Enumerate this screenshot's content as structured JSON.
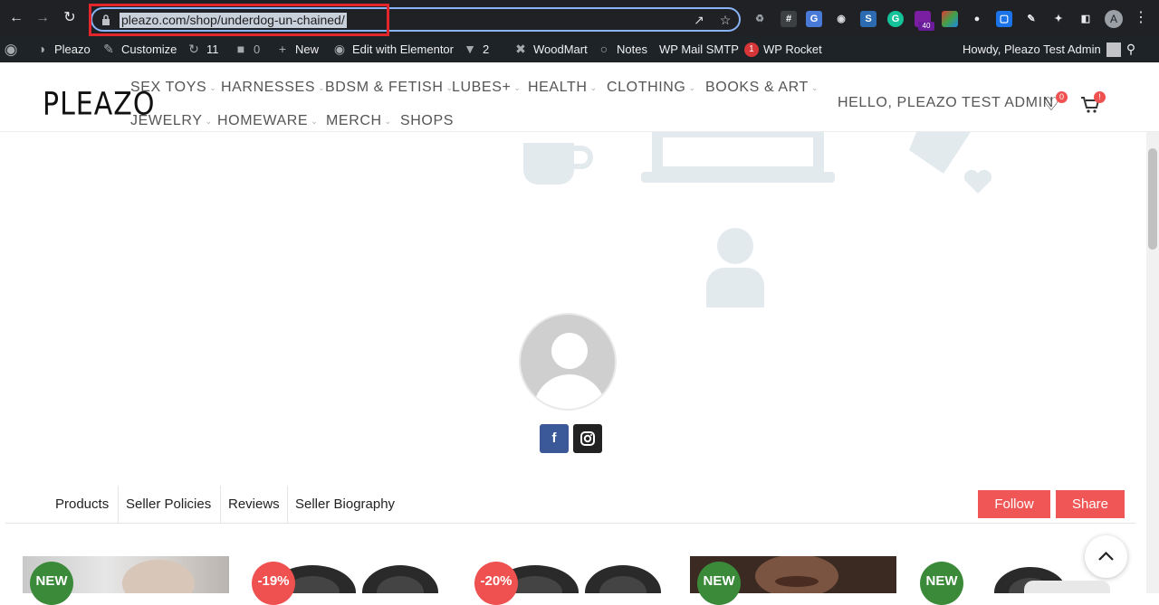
{
  "browser": {
    "url": "pleazo.com/shop/underdog-un-chained/",
    "extension_badge": "40",
    "profile_initial": "A"
  },
  "adminbar": {
    "site_name": "Pleazo",
    "customize": "Customize",
    "updates_count": "11",
    "comments_count": "0",
    "new": "New",
    "elementor": "Edit with Elementor",
    "yoast_count": "2",
    "woodmart": "WoodMart",
    "notes": "Notes",
    "mail_smtp": "WP Mail SMTP",
    "mail_smtp_count": "1",
    "wp_rocket": "WP Rocket",
    "howdy": "Howdy, Pleazo Test Admin"
  },
  "header": {
    "logo": "PLEAZO",
    "menu": [
      "SEX TOYS",
      "HARNESSES",
      "BDSM & FETISH",
      "LUBES+",
      "HEALTH",
      "CLOTHING",
      "BOOKS & ART",
      "JEWELRY",
      "HOMEWARE",
      "MERCH",
      "SHOPS"
    ],
    "greeting": "HELLO, PLEAZO TEST ADMIN",
    "wishlist_count": "0",
    "cart_count": "!"
  },
  "store": {
    "tabs": [
      "Products",
      "Seller Policies",
      "Reviews",
      "Seller Biography"
    ],
    "follow_label": "Follow",
    "share_label": "Share"
  },
  "products": [
    {
      "badge": "NEW",
      "badge_color": "#3a8a3a"
    },
    {
      "badge": "-19%",
      "badge_color": "#ef5050"
    },
    {
      "badge": "-20%",
      "badge_color": "#ef5050"
    },
    {
      "badge": "NEW",
      "badge_color": "#3a8a3a"
    },
    {
      "badge": "NEW",
      "badge_color": "#3a8a3a"
    }
  ],
  "colors": {
    "accent": "#f05656",
    "new_badge": "#3a8a3a",
    "facebook": "#3b5998",
    "instagram": "#222222"
  }
}
